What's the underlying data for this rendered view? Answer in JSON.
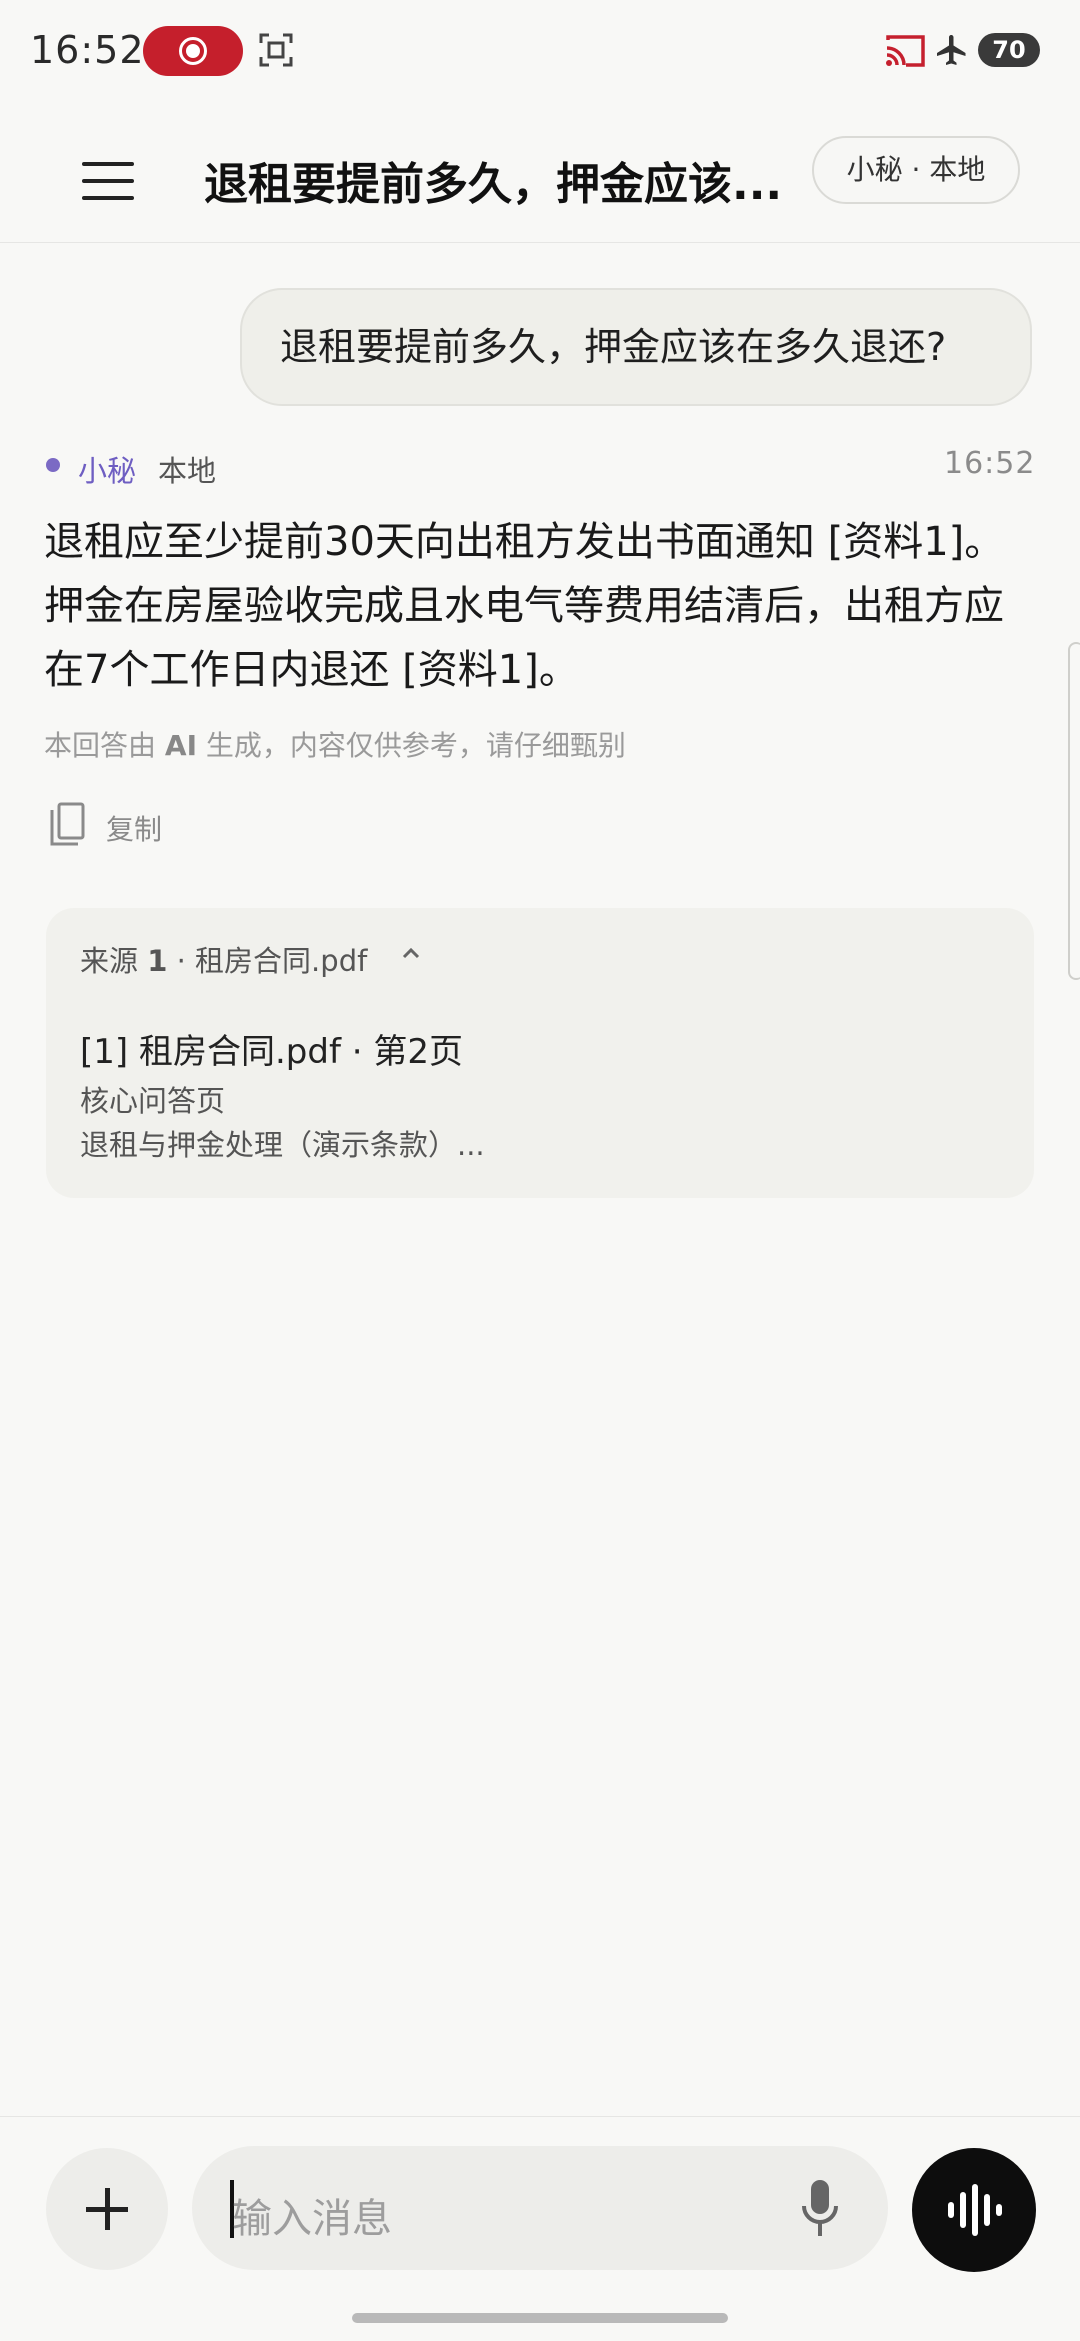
{
  "status_bar": {
    "time": "16:52",
    "battery": "70",
    "icons": [
      "screen-record-icon",
      "screenshot-icon",
      "cast-icon",
      "airplane-icon"
    ]
  },
  "app_bar": {
    "title": "退租要提前多久，押金应该...",
    "mode_chip": "小秘 · 本地"
  },
  "chat": {
    "user_message": "退租要提前多久，押金应该在多久退还?",
    "assistant": {
      "name": "小秘",
      "mode": "本地",
      "time": "16:52",
      "answer": "退租应至少提前30天向出租方发出书面通知 [资料1]。押金在房屋验收完成且水电气等费用结清后，出租方应在7个工作日内退还 [资料1]。",
      "disclaimer_prefix": "本回答由 ",
      "disclaimer_ai": "AI",
      "disclaimer_suffix": " 生成，内容仅供参考，请仔细甄别",
      "copy_label": "复制"
    },
    "sources": {
      "header_prefix": "来源 ",
      "count": "1",
      "header_suffix": " · 租房合同.pdf",
      "items": [
        {
          "title": "[1] 租房合同.pdf · 第2页",
          "line1": "核心问答页",
          "line2": "退租与押金处理（演示条款）..."
        }
      ]
    }
  },
  "composer": {
    "placeholder": "输入消息"
  },
  "colors": {
    "background": "#f8f8f6",
    "accent": "#6e5ec2",
    "record_red": "#c51f2c",
    "voice_button": "#0d0d0d"
  }
}
